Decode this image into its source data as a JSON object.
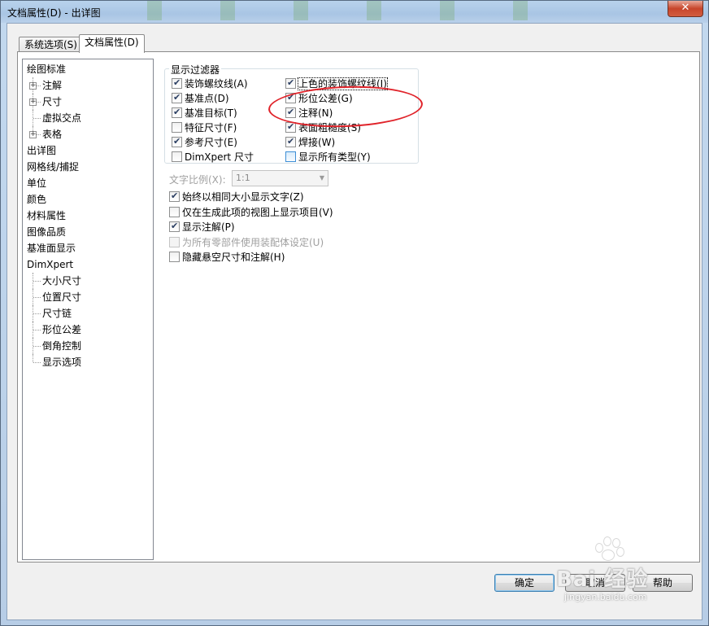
{
  "window": {
    "title": "文档属性(D) - 出详图",
    "close_glyph": "✕"
  },
  "tabs": [
    {
      "label": "系统选项(S)"
    },
    {
      "label": "文档属性(D)"
    }
  ],
  "tree": [
    {
      "label": "绘图标准",
      "level": 0
    },
    {
      "label": "注解",
      "level": 1,
      "expandable": true
    },
    {
      "label": "尺寸",
      "level": 1,
      "expandable": true
    },
    {
      "label": "虚拟交点",
      "level": 1
    },
    {
      "label": "表格",
      "level": 1,
      "expandable": true
    },
    {
      "label": "出详图",
      "level": 0
    },
    {
      "label": "网格线/捕捉",
      "level": 0
    },
    {
      "label": "单位",
      "level": 0
    },
    {
      "label": "颜色",
      "level": 0
    },
    {
      "label": "材料属性",
      "level": 0
    },
    {
      "label": "图像品质",
      "level": 0
    },
    {
      "label": "基准面显示",
      "level": 0
    },
    {
      "label": "DimXpert",
      "level": 0
    },
    {
      "label": "大小尺寸",
      "level": 1
    },
    {
      "label": "位置尺寸",
      "level": 1
    },
    {
      "label": "尺寸链",
      "level": 1
    },
    {
      "label": "形位公差",
      "level": 1
    },
    {
      "label": "倒角控制",
      "level": 1
    },
    {
      "label": "显示选项",
      "level": 1
    }
  ],
  "filter": {
    "title": "显示过滤器",
    "left": [
      {
        "label": "装饰螺纹线(A)",
        "checked": true
      },
      {
        "label": "基准点(D)",
        "checked": true
      },
      {
        "label": "基准目标(T)",
        "checked": true
      },
      {
        "label": "特征尺寸(F)",
        "checked": false
      },
      {
        "label": "参考尺寸(E)",
        "checked": true
      },
      {
        "label": "DimXpert 尺寸",
        "checked": false
      }
    ],
    "right": [
      {
        "label": "上色的装饰螺纹线(I)",
        "checked": true
      },
      {
        "label": "形位公差(G)",
        "checked": true
      },
      {
        "label": "注释(N)",
        "checked": true
      },
      {
        "label": "表面粗糙度(S)",
        "checked": true
      },
      {
        "label": "焊接(W)",
        "checked": true
      },
      {
        "label": "显示所有类型(Y)",
        "checked": false
      }
    ]
  },
  "text_scale": {
    "label": "文字比例(X):",
    "value": "1:1"
  },
  "options": [
    {
      "label": "始终以相同大小显示文字(Z)",
      "checked": true,
      "disabled": false
    },
    {
      "label": "仅在生成此项的视图上显示项目(V)",
      "checked": false,
      "disabled": false
    },
    {
      "label": "显示注解(P)",
      "checked": true,
      "disabled": false
    },
    {
      "label": "为所有零部件使用装配体设定(U)",
      "checked": false,
      "disabled": true
    },
    {
      "label": "隐藏悬空尺寸和注解(H)",
      "checked": false,
      "disabled": false
    }
  ],
  "buttons": {
    "ok": "确定",
    "cancel": "取消",
    "help": "帮助"
  },
  "watermark": {
    "brand": "Bai 经验",
    "url": "jingyan.baidu.com"
  }
}
